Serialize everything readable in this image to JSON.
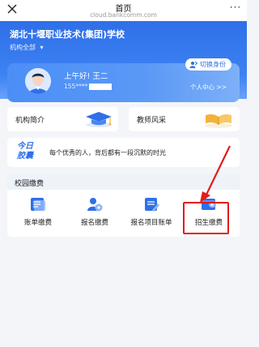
{
  "nav": {
    "title": "首页",
    "url": "cloud.bankcomm.com",
    "close_icon": "close-icon",
    "more_icon": "more-dots-icon"
  },
  "header": {
    "school_name": "湖北十堰职业技术(集团)学校",
    "org_select": "机构全部"
  },
  "user": {
    "greeting": "上午好! 王二",
    "phone": "155****",
    "switch_label": "切换身份",
    "center_label": "个人中心 >>"
  },
  "intro": {
    "items": [
      {
        "label": "机构简介",
        "icon": "graduation-cap-icon"
      },
      {
        "label": "教师风采",
        "icon": "book-icon"
      }
    ]
  },
  "quote": {
    "logo_line1": "今日",
    "logo_line2": "胶囊",
    "text": "每个优秀的人，背后都有一段沉默的时光"
  },
  "payment": {
    "title": "校园缴费",
    "items": [
      {
        "label": "账单缴费",
        "icon": "bill-icon"
      },
      {
        "label": "报名缴费",
        "icon": "register-icon"
      },
      {
        "label": "报名项目账单",
        "icon": "project-bill-icon"
      },
      {
        "label": "招生缴费",
        "icon": "enrollment-wallet-icon"
      }
    ]
  },
  "colors": {
    "primary": "#2f6fe8",
    "annotation_red": "#e31b1b",
    "background": "#f3f5f9"
  }
}
